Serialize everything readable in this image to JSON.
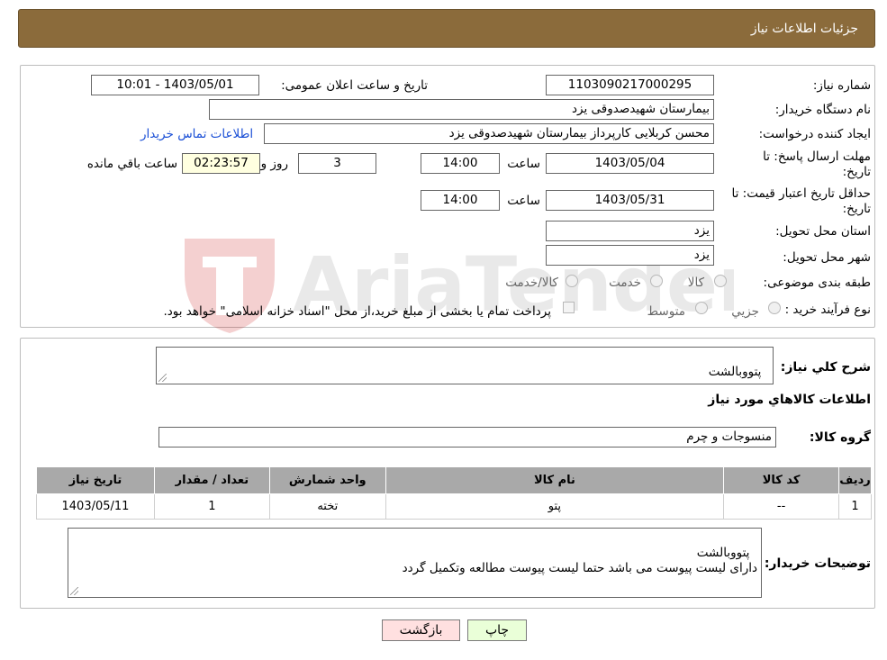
{
  "header": {
    "title": "جزئیات اطلاعات نیاز"
  },
  "fields": {
    "need_number_label": "شماره نیاز:",
    "need_number_value": "1103090217000295",
    "announce_label": "تاریخ و ساعت اعلان عمومی:",
    "announce_value": "1403/05/01 - 10:01",
    "buyer_org_label": "نام دستگاه خریدار:",
    "buyer_org_value": "بیمارستان شهیدصدوقی یزد",
    "creator_label": "ایجاد کننده درخواست:",
    "creator_value": "محسن کربلایی کارپرداز بیمارستان شهیدصدوقی یزد",
    "contact_link": "اطلاعات تماس خریدار",
    "deadline_label_1": "مهلت ارسال پاسخ: تا",
    "deadline_label_2": "تاریخ:",
    "deadline_date": "1403/05/04",
    "time_label": "ساعت",
    "deadline_time": "14:00",
    "days_value": "3",
    "days_label": "روز و",
    "remaining_value": "02:23:57",
    "remaining_label": "ساعت باقي مانده",
    "price_valid_label_1": "حداقل تاریخ اعتبار قیمت: تا",
    "price_valid_label_2": "تاریخ:",
    "price_valid_date": "1403/05/31",
    "price_valid_time": "14:00",
    "province_label": "استان محل تحویل:",
    "province_value": "یزد",
    "city_label": "شهر محل تحویل:",
    "city_value": "یزد",
    "category_label": "طبقه بندی موضوعی:",
    "category_options": [
      "کالا",
      "خدمت",
      "کالا/خدمت"
    ],
    "process_label": "نوع فرآیند خرید :",
    "process_options": [
      "جزیي",
      "متوسط"
    ],
    "payment_note": "پرداخت تمام یا بخشی از مبلغ خرید،از محل \"اسناد خزانه اسلامی\" خواهد بود."
  },
  "watermark": {
    "text": "AriaTender.neT"
  },
  "details": {
    "summary_label": "شرح کلي نياز:",
    "summary_value": "پتووبالشت",
    "goods_info_title": "اطلاعات کالاهاي مورد نياز",
    "goods_group_label": "گروه کالا:",
    "goods_group_value": "منسوجات و چرم",
    "table_headers": [
      "رديف",
      "کد کالا",
      "نام کالا",
      "واحد شمارش",
      "تعداد / مقدار",
      "تاریخ نیاز"
    ],
    "table_rows": [
      [
        "1",
        "--",
        "پتو",
        "تخته",
        "1",
        "1403/05/11"
      ]
    ],
    "buyer_notes_label": "توضیحات خریدار:",
    "buyer_notes_value": "پتووبالشت\nدارای لیست پیوست می باشد حتما لیست پیوست مطالعه وتکمیل گردد"
  },
  "buttons": {
    "print": "چاپ",
    "back": "بازگشت"
  }
}
